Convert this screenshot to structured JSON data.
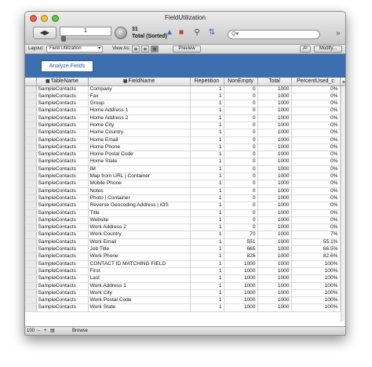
{
  "window": {
    "title": "FieldUtilization"
  },
  "toolbar": {
    "record_number": "1",
    "found_count": "31",
    "found_status": "Total (Sorted)",
    "search_placeholder": "Q▾",
    "book_icon": "book-navigation-icon",
    "more_icon": "chevron-double-right-icon"
  },
  "layout_bar": {
    "layout_label": "Layout:",
    "layout_value": "Field Utilization",
    "view_as_label": "View As:",
    "preview_label": "Preview",
    "aa_label": "A²",
    "modify_label": "Modify..."
  },
  "header": {
    "analyze_label": "Analyze Fields"
  },
  "colors": {
    "header_band": "#3b6fb0",
    "accent": "#2c5aa0"
  },
  "table": {
    "columns": [
      "TableName",
      "FieldName",
      "Repetition",
      "NonEmpty",
      "Total",
      "PercentUsed_c"
    ],
    "rows": [
      [
        "SampleContacts",
        "Company",
        "1",
        "0",
        "1000",
        "0%"
      ],
      [
        "SampleContacts",
        "Fax",
        "1",
        "0",
        "1000",
        "0%"
      ],
      [
        "SampleContacts",
        "Group",
        "1",
        "0",
        "1000",
        "0%"
      ],
      [
        "SampleContacts",
        "Home Address 1",
        "1",
        "0",
        "1000",
        "0%"
      ],
      [
        "SampleContacts",
        "Home Address 2",
        "1",
        "0",
        "1000",
        "0%"
      ],
      [
        "SampleContacts",
        "Home City",
        "1",
        "0",
        "1000",
        "0%"
      ],
      [
        "SampleContacts",
        "Home Country",
        "1",
        "0",
        "1000",
        "0%"
      ],
      [
        "SampleContacts",
        "Home Email",
        "1",
        "0",
        "1000",
        "0%"
      ],
      [
        "SampleContacts",
        "Home Phone",
        "1",
        "0",
        "1000",
        "0%"
      ],
      [
        "SampleContacts",
        "Home Postal Code",
        "1",
        "0",
        "1000",
        "0%"
      ],
      [
        "SampleContacts",
        "Home State",
        "1",
        "0",
        "1000",
        "0%"
      ],
      [
        "SampleContacts",
        "IM",
        "1",
        "0",
        "1000",
        "0%"
      ],
      [
        "SampleContacts",
        "Map from URL | Container",
        "1",
        "0",
        "1000",
        "0%"
      ],
      [
        "SampleContacts",
        "Mobile Phone",
        "1",
        "0",
        "1000",
        "0%"
      ],
      [
        "SampleContacts",
        "Notes",
        "1",
        "0",
        "1000",
        "0%"
      ],
      [
        "SampleContacts",
        "Photo | Container",
        "1",
        "0",
        "1000",
        "0%"
      ],
      [
        "SampleContacts",
        "Reverse Geocoding Address | iOS",
        "1",
        "0",
        "1000",
        "0%"
      ],
      [
        "SampleContacts",
        "Title",
        "1",
        "0",
        "1000",
        "0%"
      ],
      [
        "SampleContacts",
        "Website",
        "1",
        "0",
        "1000",
        "0%"
      ],
      [
        "SampleContacts",
        "Work Address 2",
        "1",
        "0",
        "1000",
        "0%"
      ],
      [
        "SampleContacts",
        "Work Country",
        "1",
        "70",
        "1000",
        "7%"
      ],
      [
        "SampleContacts",
        "Work Email",
        "1",
        "551",
        "1000",
        "55.1%"
      ],
      [
        "SampleContacts",
        "Job Title",
        "1",
        "665",
        "1000",
        "66.5%"
      ],
      [
        "SampleContacts",
        "Work Phone",
        "1",
        "826",
        "1000",
        "82.6%"
      ],
      [
        "SampleContacts",
        "CONTACT ID MATCHING FIELD",
        "1",
        "1000",
        "1000",
        "100%"
      ],
      [
        "SampleContacts",
        "First",
        "1",
        "1000",
        "1000",
        "100%"
      ],
      [
        "SampleContacts",
        "Last",
        "1",
        "1000",
        "1000",
        "100%"
      ],
      [
        "SampleContacts",
        "Work Address 1",
        "1",
        "1000",
        "1000",
        "100%"
      ],
      [
        "SampleContacts",
        "Work City",
        "1",
        "1000",
        "1000",
        "100%"
      ],
      [
        "SampleContacts",
        "Work Postal Code",
        "1",
        "1000",
        "1000",
        "100%"
      ],
      [
        "SampleContacts",
        "Work State",
        "1",
        "1000",
        "1000",
        "100%"
      ]
    ]
  },
  "status_bar": {
    "zoom": "100",
    "mode": "Browse"
  }
}
